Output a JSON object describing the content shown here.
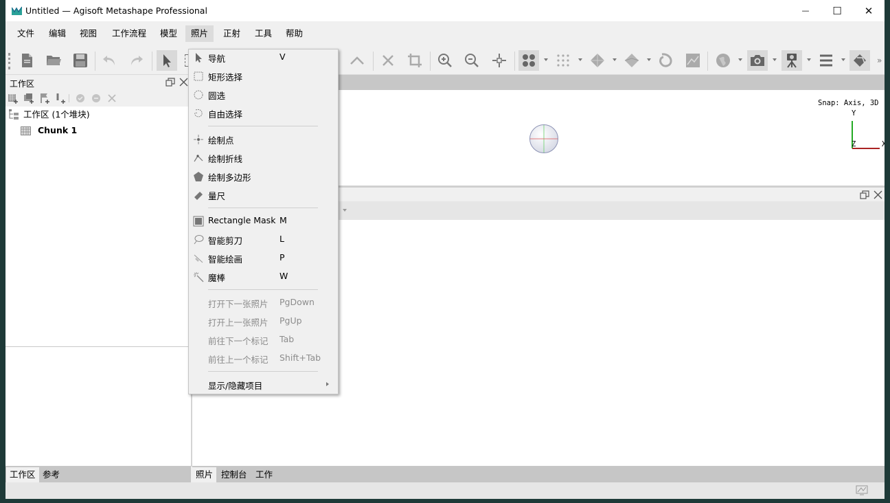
{
  "window": {
    "title": "Untitled — Agisoft Metashape Professional",
    "controls": {
      "minimize": "—",
      "maximize": "☐",
      "close": "✕"
    }
  },
  "menubar": {
    "items": [
      "文件",
      "编辑",
      "视图",
      "工作流程",
      "模型",
      "照片",
      "正射",
      "工具",
      "帮助"
    ],
    "active_index": 5
  },
  "workspace": {
    "header": "工作区",
    "root_label": "工作区 (1个堆块)",
    "chunk_label": "Chunk 1"
  },
  "model_view": {
    "snap_text": "Snap: Axis, 3D",
    "axis_y": "Y",
    "axis_x": "X",
    "axis_z": "Z"
  },
  "bottom_tabs_left": [
    "工作区",
    "参考"
  ],
  "bottom_tabs_right": [
    "照片",
    "控制台",
    "工作"
  ],
  "photo_menu": {
    "items": [
      {
        "label": "导航",
        "shortcut": "V",
        "icon": "arrow-cursor-icon",
        "disabled": false
      },
      {
        "label": "矩形选择",
        "shortcut": "",
        "icon": "rectangle-select-icon",
        "disabled": false
      },
      {
        "label": "圆选",
        "shortcut": "",
        "icon": "circle-select-icon",
        "disabled": false
      },
      {
        "label": "自由选择",
        "shortcut": "",
        "icon": "free-select-icon",
        "disabled": false
      },
      {
        "label": "绘制点",
        "shortcut": "",
        "icon": "draw-point-icon",
        "disabled": false
      },
      {
        "label": "绘制折线",
        "shortcut": "",
        "icon": "draw-polyline-icon",
        "disabled": false
      },
      {
        "label": "绘制多边形",
        "shortcut": "",
        "icon": "draw-polygon-icon",
        "disabled": false
      },
      {
        "label": "量尺",
        "shortcut": "",
        "icon": "ruler-icon",
        "disabled": false
      },
      {
        "label": "Rectangle Mask",
        "shortcut": "M",
        "icon": "rectangle-mask-icon",
        "disabled": false
      },
      {
        "label": "智能剪刀",
        "shortcut": "L",
        "icon": "intelligent-scissors-icon",
        "disabled": false
      },
      {
        "label": "智能绘画",
        "shortcut": "P",
        "icon": "intelligent-paint-icon",
        "disabled": false
      },
      {
        "label": "魔棒",
        "shortcut": "W",
        "icon": "magic-wand-icon",
        "disabled": false
      },
      {
        "label": "打开下一张照片",
        "shortcut": "PgDown",
        "icon": "",
        "disabled": true
      },
      {
        "label": "打开上一张照片",
        "shortcut": "PgUp",
        "icon": "",
        "disabled": true
      },
      {
        "label": "前往下一个标记",
        "shortcut": "Tab",
        "icon": "",
        "disabled": true
      },
      {
        "label": "前往上一个标记",
        "shortcut": "Shift+Tab",
        "icon": "",
        "disabled": true
      },
      {
        "label": "显示/隐藏项目",
        "shortcut": "",
        "icon": "",
        "disabled": false
      }
    ]
  },
  "colors": {
    "accent_green": "#2aa198",
    "axis_y": "#22aa22",
    "axis_x": "#aa2222"
  }
}
